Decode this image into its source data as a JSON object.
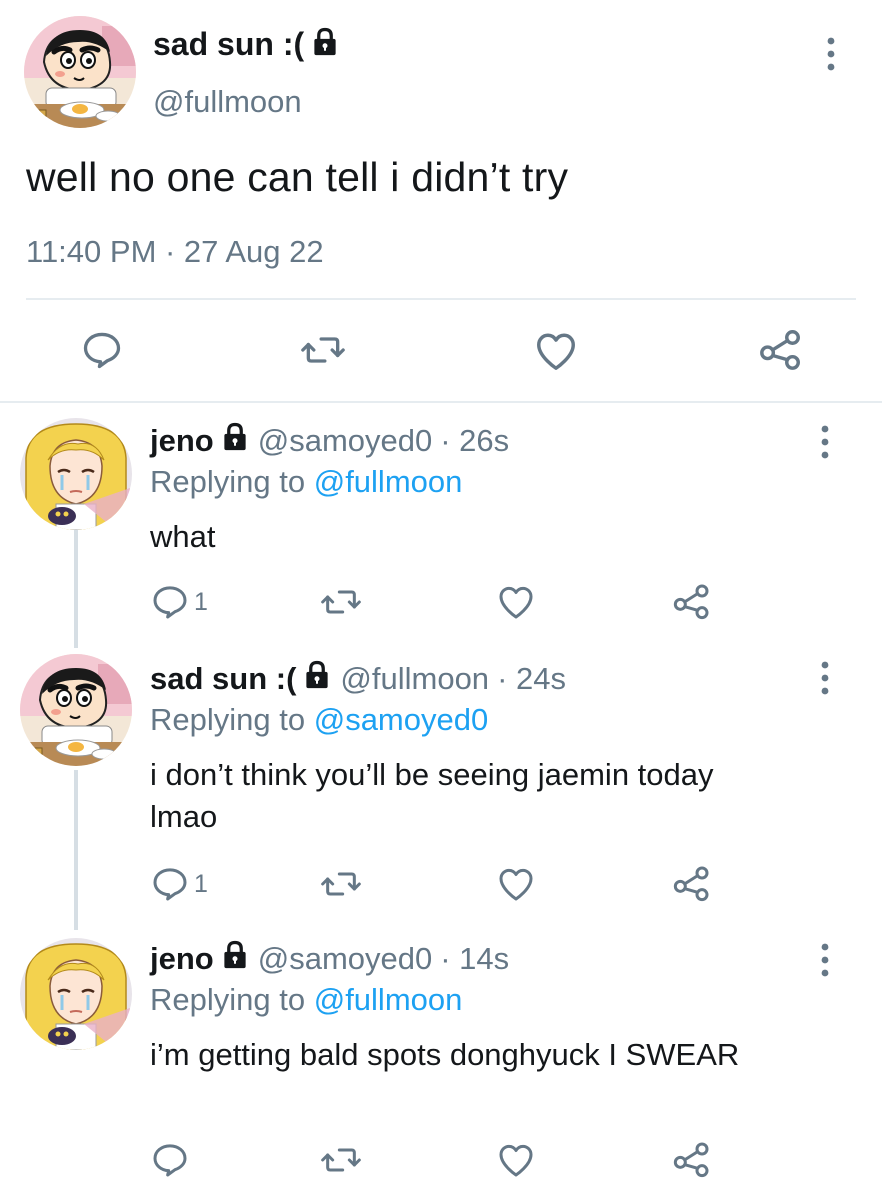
{
  "main_tweet": {
    "name": "sad sun :(",
    "handle": "@fullmoon",
    "text": "well no one can tell i didn’t try",
    "timestamp": "11:40 PM · 27 Aug 22",
    "icons": [
      "comment-icon",
      "retweet-icon",
      "like-icon",
      "share-icon"
    ]
  },
  "replies": [
    {
      "name": "jeno",
      "handle": "@samoyed0",
      "time": "· 26s",
      "replying_label": "Replying to ",
      "replying_to": "@fullmoon",
      "text": "what",
      "reply_count": "1",
      "avatar": "sailor-moon-avatar"
    },
    {
      "name": "sad sun :(",
      "handle": "@fullmoon",
      "time": "· 24s",
      "replying_label": "Replying to ",
      "replying_to": "@samoyed0",
      "text": "i don’t think you’ll be seeing jaemin today lmao",
      "reply_count": "1",
      "avatar": "shinchan-avatar"
    },
    {
      "name": "jeno",
      "handle": "@samoyed0",
      "time": "· 14s",
      "replying_label": "Replying to ",
      "replying_to": "@fullmoon",
      "text": "i’m getting bald spots donghyuck I SWEAR",
      "reply_count": "",
      "avatar": "sailor-moon-avatar"
    }
  ],
  "colors": {
    "text": "#14171a",
    "secondary": "#657786",
    "link": "#1da1f2",
    "divider": "#e6ecf0"
  }
}
